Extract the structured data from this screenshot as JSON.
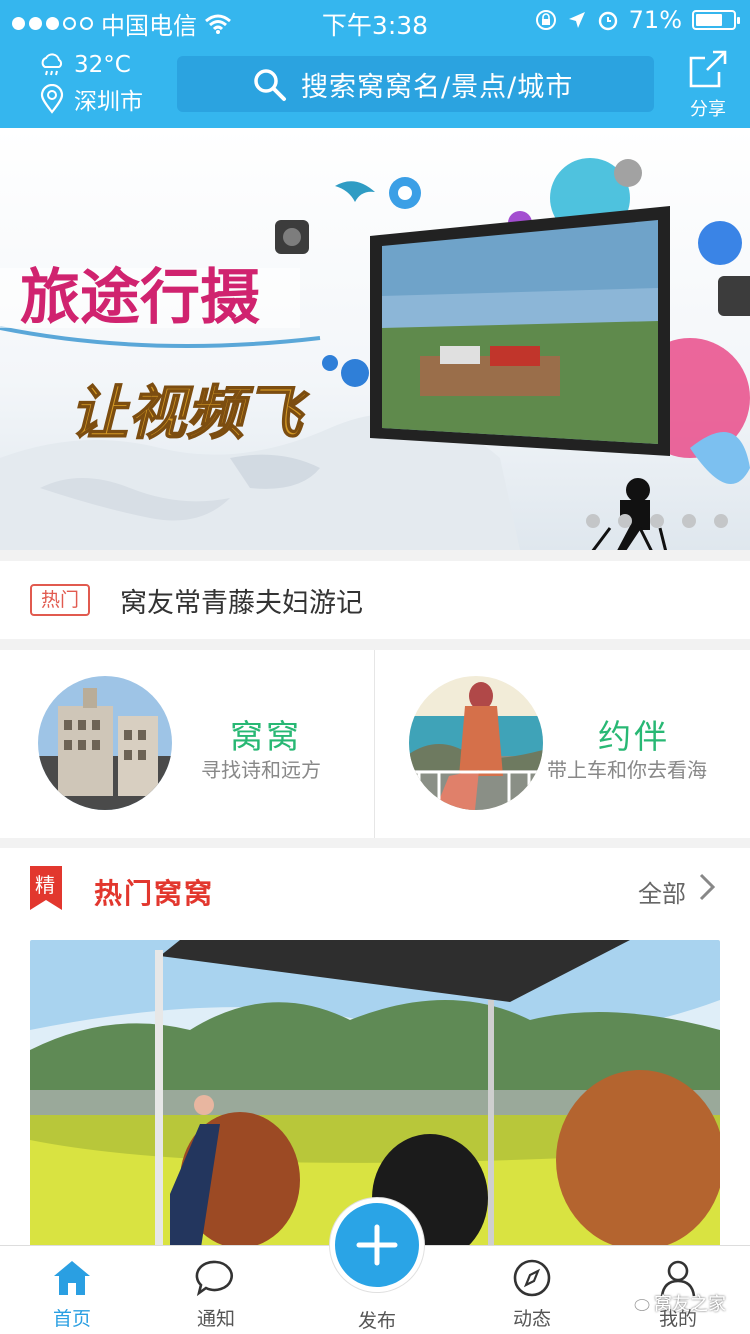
{
  "status_bar": {
    "carrier": "中国电信",
    "time": "下午3:38",
    "battery": "71%",
    "battery_level": 0.71
  },
  "header": {
    "temperature": "32°C",
    "city": "深圳市",
    "search_placeholder": "搜索窝窝名/景点/城市",
    "share_label": "分享"
  },
  "banner": {
    "line1": "旅途行摄",
    "line2": "让视频飞",
    "page_count": 5
  },
  "hot_news": {
    "tag": "热门",
    "text": "窝友常青藤夫妇游记"
  },
  "cards": [
    {
      "title": "窝窝",
      "subtitle": "寻找诗和远方"
    },
    {
      "title": "约伴",
      "subtitle": "带上车和你去看海"
    }
  ],
  "section": {
    "badge": "精",
    "title": "热门窝窝",
    "all_label": "全部"
  },
  "tabbar": {
    "home": "首页",
    "notify": "通知",
    "publish": "发布",
    "feed": "动态",
    "mine": "我的"
  },
  "watermark": "窝友之家",
  "colors": {
    "brand_blue": "#35b6ee",
    "accent_green": "#28b874",
    "hot_red": "#e2372e"
  }
}
